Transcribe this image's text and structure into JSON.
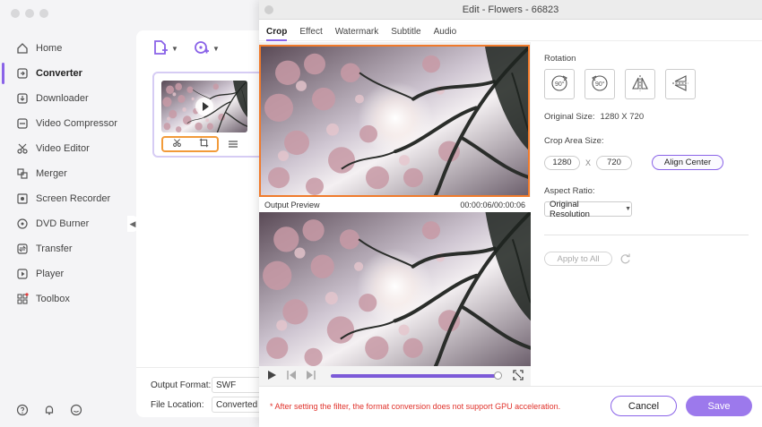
{
  "sidebar": {
    "items": [
      {
        "label": "Home",
        "icon": "home-icon"
      },
      {
        "label": "Converter",
        "icon": "converter-icon",
        "active": true
      },
      {
        "label": "Downloader",
        "icon": "downloader-icon"
      },
      {
        "label": "Video Compressor",
        "icon": "compress-icon"
      },
      {
        "label": "Video Editor",
        "icon": "scissors-icon"
      },
      {
        "label": "Merger",
        "icon": "merger-icon"
      },
      {
        "label": "Screen Recorder",
        "icon": "screen-recorder-icon"
      },
      {
        "label": "DVD Burner",
        "icon": "disc-icon"
      },
      {
        "label": "Transfer",
        "icon": "transfer-icon"
      },
      {
        "label": "Player",
        "icon": "player-icon"
      },
      {
        "label": "Toolbox",
        "icon": "toolbox-icon"
      }
    ]
  },
  "main": {
    "output_format_label": "Output Format:",
    "output_format_value": "SWF",
    "file_location_label": "File Location:",
    "file_location_value": "Converted"
  },
  "editor": {
    "title": "Edit - Flowers - 66823",
    "tabs": [
      "Crop",
      "Effect",
      "Watermark",
      "Subtitle",
      "Audio"
    ],
    "active_tab": "Crop",
    "output_preview_label": "Output Preview",
    "timecode": "00:00:06/00:00:06",
    "progress": 1.0,
    "rotation_label": "Rotation",
    "original_size_label": "Original Size:",
    "original_size_value": "1280 X 720",
    "crop_area_label": "Crop Area Size:",
    "crop_width": "1280",
    "crop_sep": "X",
    "crop_height": "720",
    "align_center": "Align Center",
    "aspect_ratio_label": "Aspect Ratio:",
    "aspect_ratio_value": "Original Resolution",
    "apply_to_all": "Apply to All",
    "warning": "* After setting the filter, the format conversion does not support GPU acceleration.",
    "cancel": "Cancel",
    "save": "Save"
  },
  "colors": {
    "accent": "#8a63e8",
    "crop_border": "#f07a2b",
    "warning": "#e0322b",
    "save_button": "#9c79ec"
  }
}
